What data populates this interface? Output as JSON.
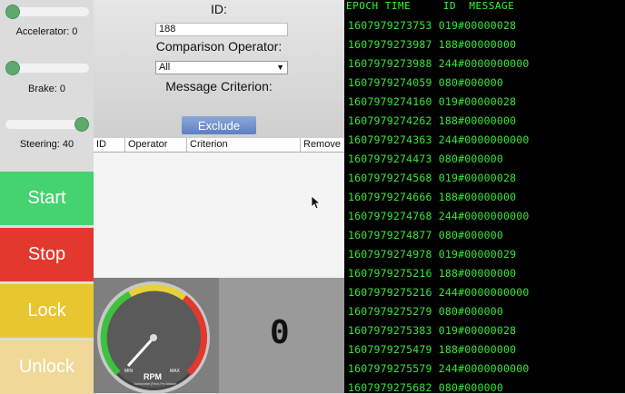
{
  "controls": {
    "accelerator_label": "Accelerator: 0",
    "brake_label": "Brake: 0",
    "steering_label": "Steering: 40",
    "accelerator_value": 0,
    "brake_value": 0,
    "steering_value": 40,
    "start_label": "Start",
    "stop_label": "Stop",
    "lock_label": "Lock",
    "unlock_label": "Unlock",
    "colors": {
      "start": "#45d36f",
      "stop": "#e2382d",
      "lock": "#e8c62f",
      "unlock": "#efd898"
    }
  },
  "filter": {
    "id_label": "ID:",
    "id_value": "188",
    "operator_label": "Comparison Operator:",
    "operator_selected": "All",
    "criterion_label": "Message Criterion:",
    "exclude_label": "Exclude",
    "table_headers": [
      "ID",
      "Operator",
      "Criterion",
      "Remove"
    ]
  },
  "gauges": {
    "rpm_label": "RPM",
    "rpm_min": "MIN",
    "rpm_max": "MAX",
    "rpm_subtitle": "Tachometer (Revs Per Minute)",
    "speed_value": "0"
  },
  "console": {
    "header": "EPOCH TIME     ID  MESSAGE",
    "lines": [
      "1607979273753 019#00000028",
      "1607979273987 188#00000000",
      "1607979273988 244#0000000000",
      "1607979274059 080#000000",
      "1607979274160 019#00000028",
      "1607979274262 188#00000000",
      "1607979274363 244#0000000000",
      "1607979274473 080#000000",
      "1607979274568 019#00000028",
      "1607979274666 188#00000000",
      "1607979274768 244#0000000000",
      "1607979274877 080#000000",
      "1607979274978 019#00000029",
      "1607979275216 188#00000000",
      "1607979275216 244#0000000000",
      "1607979275279 080#000000",
      "1607979275383 019#00000028",
      "1607979275479 188#00000000",
      "1607979275579 244#0000000000",
      "1607979275682 080#000000"
    ]
  }
}
